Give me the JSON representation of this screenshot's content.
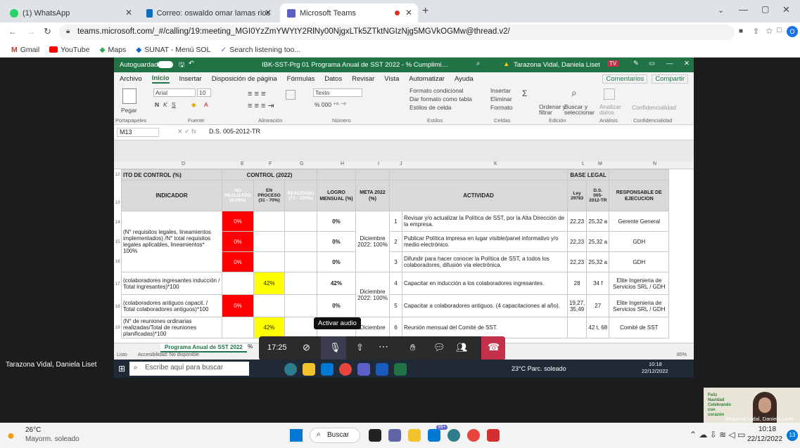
{
  "browser": {
    "tabs": [
      {
        "label": "(1) WhatsApp"
      },
      {
        "label": "Correo: oswaldo omar lamas rios"
      },
      {
        "label": "Microsoft Teams"
      }
    ],
    "url": "teams.microsoft.com/_#/calling/19:meeting_MGI0YzZmYWYtY2RlNy00NjgxLTk5ZTktNGIzNjg5MGVkOGMw@thread.v2/",
    "bookmarks": [
      "Gmail",
      "YouTube",
      "Maps",
      "SUNAT - Menú SOL",
      "Search listening too..."
    ],
    "profile_initial": "O"
  },
  "excel": {
    "autosave": "Autoguardado",
    "title": "IBK-SST-Prg 01 Programa Anual de SST 2022 - % Cumplimiento a Octubre 2022 (2) - Modo de...",
    "user": "Tarazona Vidal, Daniela Liset",
    "user_initials": "TV",
    "menu": [
      "Archivo",
      "Inicio",
      "Insertar",
      "Disposición de página",
      "Fórmulas",
      "Datos",
      "Revisar",
      "Vista",
      "Automatizar",
      "Ayuda"
    ],
    "comentarios": "Comentarios",
    "compartir": "Compartir",
    "ribbon": {
      "groups": [
        "Portapapeles",
        "Fuente",
        "Alineación",
        "Número",
        "Estilos",
        "Celdas",
        "Edición",
        "Análisis",
        "Confidencialidad"
      ],
      "paste": "Pegar",
      "font": "Arial",
      "size": "10",
      "numfmt": "Texto",
      "styles": [
        "Formato condicional",
        "Dar formato como tabla",
        "Estilos de celda"
      ],
      "cells": [
        "Insertar",
        "Eliminar",
        "Formato"
      ],
      "edit": [
        "Ordenar y filtrar",
        "Buscar y seleccionar"
      ],
      "analyze": "Analizar datos",
      "confid": "Confidencialidad"
    },
    "namebox": "M13",
    "formula": "D.S. 005-2012-TR",
    "columns": [
      "D",
      "E",
      "F",
      "G",
      "H",
      "I",
      "J",
      "K",
      "L",
      "M",
      "N"
    ],
    "row12": {
      "d": "ITO DE CONTROL (%)",
      "efg": "CONTROL (2022)",
      "lm": "BASE LEGAL"
    },
    "row13": {
      "d": "INDICADOR",
      "e": "NO REALIZADO (0-30%)",
      "f": "EN PROCESO (31 - 70%)",
      "g": "REALIZADO (71 - 100%)",
      "h": "LOGRO MENSUAL (%)",
      "i": "META 2022 (%)",
      "k": "ACTIVIDAD",
      "l": "Ley 29783",
      "m": "D.S. 005-2012-TR",
      "n": "RESPONSABLE DE EJECUCION"
    },
    "rows": [
      {
        "rn": "14",
        "e": "0%",
        "h": "0%",
        "j": "1",
        "k": "Revisar y/o actualizar la Política de SST, por la Alta Dirección de la empresa.",
        "l": "22,23",
        "m": "25,32 a",
        "n": "Gerente General"
      },
      {
        "rn": "15",
        "e": "0%",
        "h": "0%",
        "j": "2",
        "k": "Publicar Política impresa en lugar visible/panel informativo y/o medio electrónico.",
        "l": "22,23",
        "m": "25,32 a",
        "n": "GDH"
      },
      {
        "rn": "16",
        "e": "0%",
        "h": "0%",
        "j": "3",
        "k": "Difundir para hacer conocer la Política de SST, a todos los colaboradores, difusión vía electrónica.",
        "l": "22,23",
        "m": "25,32 a",
        "n": "GDH"
      },
      {
        "rn": "17",
        "f": "42%",
        "h": "42%",
        "j": "4",
        "k": "Capacitar en inducción a los colaboradores ingresantes.",
        "l": "28",
        "m": "34 f",
        "n": "Elite Ingenieria de Servicios SRL / GDH"
      },
      {
        "rn": "18",
        "e": "0%",
        "h": "0%",
        "j": "5",
        "k": "Capacitar a colaboradores antiguos. (4 capacitaciones al año).",
        "l": "19,27, 35,49",
        "m": "27",
        "n": "Elite Ingenieria de Servicios SRL / GDH"
      },
      {
        "rn": "19",
        "f": "42%",
        "h": "",
        "j": "6",
        "k": "Reunión mensual del Comité de SST.",
        "l": "",
        "m": "42 t, 68",
        "n": "Comité de SST"
      }
    ],
    "indicator1": "(N° requisitos legales, lineamientos implementados) /N° total requisitos legales aplicables, lineamientos* 100%",
    "meta1": "Diciembre 2022: 100%",
    "indicator2": "(colaboradores ingresantes inducción / Total ingresantes)*100",
    "indicator3": "(colaboradores antiguos capacit. / Total colaboradores antiguos)*100",
    "meta2": "Diciembre 2022: 100%",
    "indicator4": "(N° de reuniones ordinarias realizadas/Total de reuniones planificadas)*100",
    "meta3": "Diciembre",
    "sheet_tab": "Programa Anual de SST 2022",
    "status_ready": "Listo",
    "status_access": "Accesibilidad: No disponible",
    "zoom": "85%"
  },
  "teams": {
    "tooltip": "Activar audio",
    "timer": "17:25",
    "presenter_name": "Tarazona Vidal, Daniela Liset",
    "thumb_name": "Tarazona Vidal, Daniela Liset",
    "thumb_text": "Feliz Navidad Celebrando con corazón"
  },
  "shared_taskbar": {
    "search": "Escribe aquí para buscar",
    "weather": "23°C Parc. soleado",
    "time": "10:18",
    "date": "22/12/2022"
  },
  "os_taskbar": {
    "temp": "26°C",
    "weather": "Mayorm. soleado",
    "search": "Buscar",
    "badge": "99+",
    "time": "10:18",
    "date": "22/12/2022",
    "notif": "13"
  }
}
